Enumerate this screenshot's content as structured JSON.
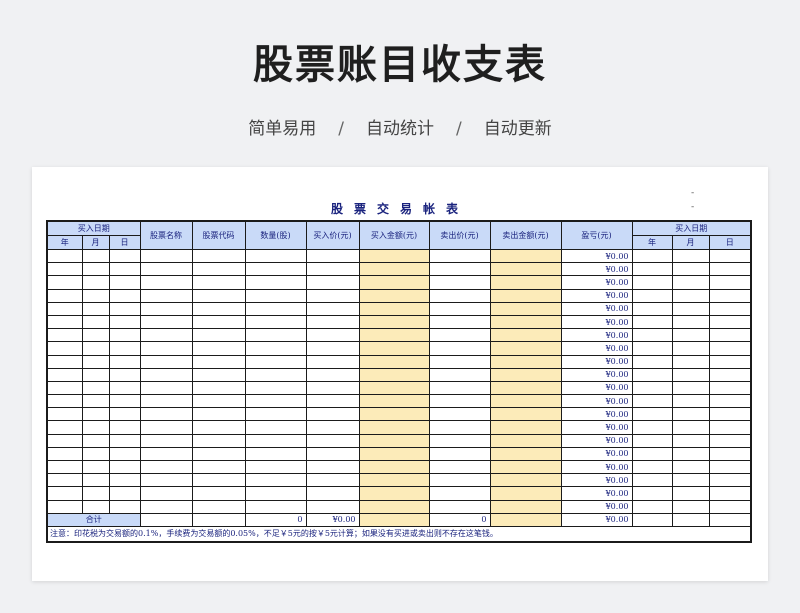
{
  "header": {
    "title": "股票账目收支表",
    "tags": [
      "简单易用",
      "自动统计",
      "自动更新"
    ],
    "separator": "/"
  },
  "sheet": {
    "title": "股票交易帐表",
    "dash_marks": [
      "-",
      "-"
    ],
    "columns": {
      "buy_date": "买入日期",
      "year": "年",
      "month": "月",
      "day": "日",
      "stock_name": "股票名称",
      "stock_code": "股票代码",
      "quantity": "数量(股)",
      "buy_price": "买入价(元)",
      "buy_amount": "买入金额(元)",
      "sell_price": "卖出价(元)",
      "sell_amount": "卖出金额(元)",
      "pnl": "盈亏(元)",
      "sell_date": "买入日期"
    },
    "rows_pnl": [
      "¥0.00",
      "¥0.00",
      "¥0.00",
      "¥0.00",
      "¥0.00",
      "¥0.00",
      "¥0.00",
      "¥0.00",
      "¥0.00",
      "¥0.00",
      "¥0.00",
      "¥0.00",
      "¥0.00",
      "¥0.00",
      "¥0.00",
      "¥0.00",
      "¥0.00",
      "¥0.00",
      "¥0.00",
      "¥0.00"
    ],
    "total": {
      "label": "合计",
      "quantity": "0",
      "buy_price": "¥0.00",
      "sell_price": "0",
      "pnl": "¥0.00"
    },
    "note": "注意：印花税为交易额的0.1%，手续费为交易额的0.05%，不足￥5元的按￥5元计算；如果没有买进或卖出则不存在这笔钱。"
  },
  "colors": {
    "header_fill": "#c9daf8",
    "amount_fill": "#fcebb9",
    "text_navy": "#1a237e"
  }
}
